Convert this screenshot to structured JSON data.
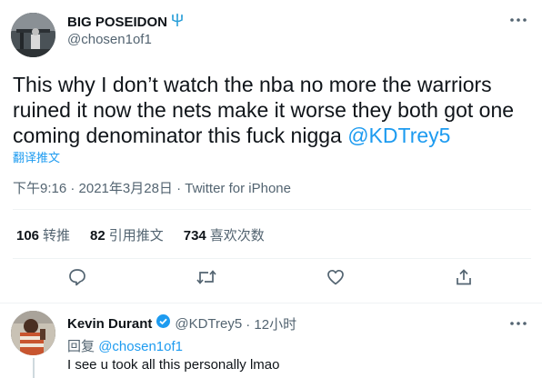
{
  "tweet": {
    "author_name": "BIG POSEIDON",
    "author_handle": "@chosen1of1",
    "text_before_mention": "This why I don’t watch the nba no more the warriors ruined it now the nets make it worse they both got one coming denominator this fuck nigga ",
    "mention": "@KDTrey5",
    "translate_label": "翻译推文",
    "timestamp": "下午9:16 · 2021年3月28日 · Twitter for iPhone",
    "stats": {
      "retweets_count": "106",
      "retweets_label": "转推",
      "quotes_count": "82",
      "quotes_label": "引用推文",
      "likes_count": "734",
      "likes_label": "喜欢次数"
    }
  },
  "reply": {
    "author_name": "Kevin Durant",
    "author_handle": "@KDTrey5",
    "time_ago": "· 12小时",
    "replying_prefix": "回复",
    "replying_to": "@chosen1of1",
    "text": "I see u took all this personally lmao"
  },
  "icons": {
    "more": "more-horizontal-icon",
    "reply": "reply-bubble-icon",
    "retweet": "retweet-icon",
    "like": "heart-icon",
    "share": "share-icon",
    "verified": "verified-badge-icon",
    "emoji": "trident-emoji-icon"
  },
  "colors": {
    "accent": "#1d9bf0",
    "text_primary": "#0f1419",
    "text_secondary": "#536471",
    "divider": "#eff3f4"
  }
}
